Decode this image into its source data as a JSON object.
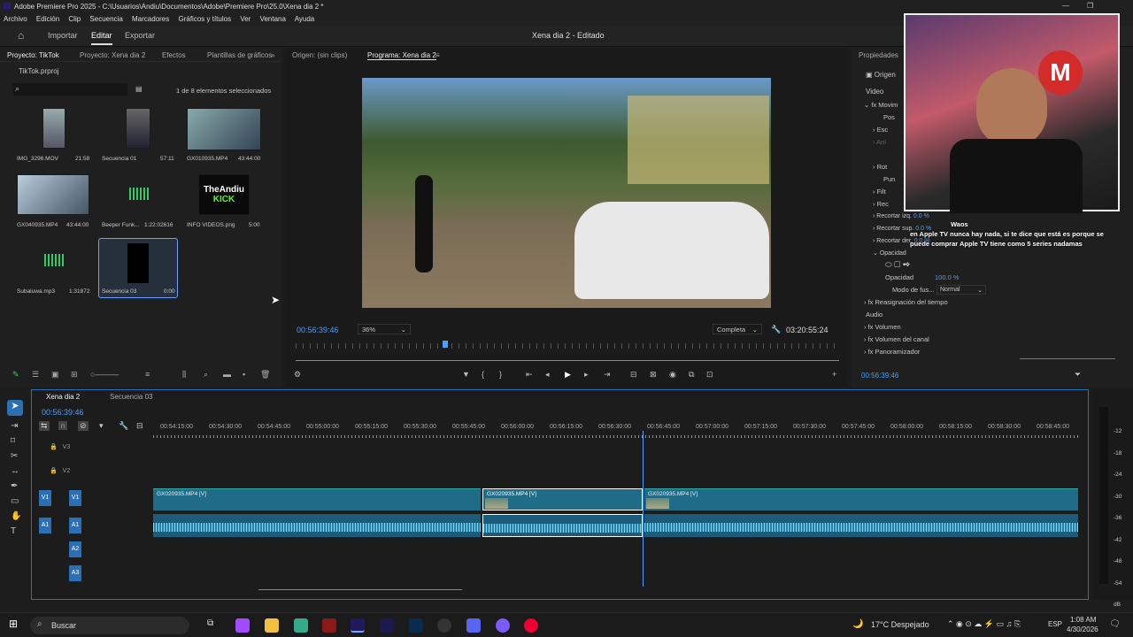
{
  "window": {
    "title": "Adobe Premiere Pro 2025 - C:\\Usuarios\\Andiu\\Documentos\\Adobe\\Premiere Pro\\25.0\\Xena dia 2 *"
  },
  "menu": [
    "Archivo",
    "Edición",
    "Clip",
    "Secuencia",
    "Marcadores",
    "Gráficos y títulos",
    "Ver",
    "Ventana",
    "Ayuda"
  ],
  "nav": {
    "import": "Importar",
    "edit": "Editar",
    "export": "Exportar",
    "doc_title": "Xena dia 2",
    "doc_status": "- Editado"
  },
  "project": {
    "tabs": [
      "Proyecto: TikTok",
      "Proyecto: Xena dia 2",
      "Efectos",
      "Plantillas de gráficos"
    ],
    "file": "TikTok.prproj",
    "selection": "1 de 8 elementos seleccionados",
    "items": [
      {
        "name": "IMG_3296.MOV",
        "dur": "21:58"
      },
      {
        "name": "Secuencia 01",
        "dur": "57:11"
      },
      {
        "name": "GX010935.MP4",
        "dur": "43:44:00"
      },
      {
        "name": "GX040935.MP4",
        "dur": "43:44:00"
      },
      {
        "name": "Beeper Funk...",
        "dur": "1:22:02616"
      },
      {
        "name": "INFO VIDEOS.png",
        "dur": "5:00"
      },
      {
        "name": "Subaluwa.mp3",
        "dur": "1:31872"
      },
      {
        "name": "Secuencia 03",
        "dur": "0:00"
      }
    ],
    "logo": {
      "brand": "TheAndiu",
      "sub": "KICK"
    }
  },
  "monitor": {
    "source_tab": "Origen: (sin clips)",
    "program_tab": "Programa: Xena dia 2",
    "timecode": "00:56:39:46",
    "zoom": "36%",
    "quality": "Completa",
    "duration": "03:20:55:24"
  },
  "properties": {
    "title": "Propiedades",
    "origin": "Origen",
    "video": "Video",
    "rows": [
      "Movim",
      "Pos",
      "Esc",
      "Ani",
      "Rot",
      "Pun",
      "Filt",
      "Rec",
      "Recortar izq.",
      "Recortar sup.",
      "Recortar der.",
      "Opacidad"
    ],
    "crop_val": "0.0 %",
    "opacity_label": "Opacidad",
    "opacity_val": "100.0 %",
    "blend_label": "Modo de fus...",
    "blend_val": "Normal",
    "time_remap": "Reasignación del tiempo",
    "audio": "Audio",
    "volume": "Volumen",
    "channel_volume": "Volumen del canal",
    "panner": "Panoramizador",
    "timecode": "00:56:39:46"
  },
  "chat": {
    "user": "Waos",
    "message": "en Apple TV nunca hay nada, si te dice que está es porque se puede comprar Apple TV tiene como 5 series nadamas"
  },
  "timeline": {
    "tabs": [
      "Xena dia 2",
      "Secuencia 03"
    ],
    "timecode": "00:56:39:46",
    "ruler": [
      "00:54:15:00",
      "00:54:30:00",
      "00:54:45:00",
      "00:55:00:00",
      "00:55:15:00",
      "00:55:30:00",
      "00:55:45:00",
      "00:56:00:00",
      "00:56:15:00",
      "00:56:30:00",
      "00:56:45:00",
      "00:57:00:00",
      "00:57:15:00",
      "00:57:30:00",
      "00:57:45:00",
      "00:58:00:00",
      "00:58:15:00",
      "00:58:30:00",
      "00:58:45:00"
    ],
    "tracks": [
      "V3",
      "V2",
      "V1",
      "A1",
      "A2",
      "A3"
    ],
    "clip_label": "GX020935.MP4 [V]",
    "meter_ticks": [
      "-12",
      "-18",
      "-24",
      "-30",
      "-36",
      "-42",
      "-48",
      "-54",
      "dB"
    ]
  },
  "taskbar": {
    "search": "Buscar",
    "weather": "17°C Despejado",
    "lang": "ESP",
    "time": "1:08 AM",
    "date": "4/30/2026"
  },
  "colors": {
    "accent": "#2b6fb5",
    "clip": "#1f6c88",
    "timecode": "#4a9eff"
  }
}
